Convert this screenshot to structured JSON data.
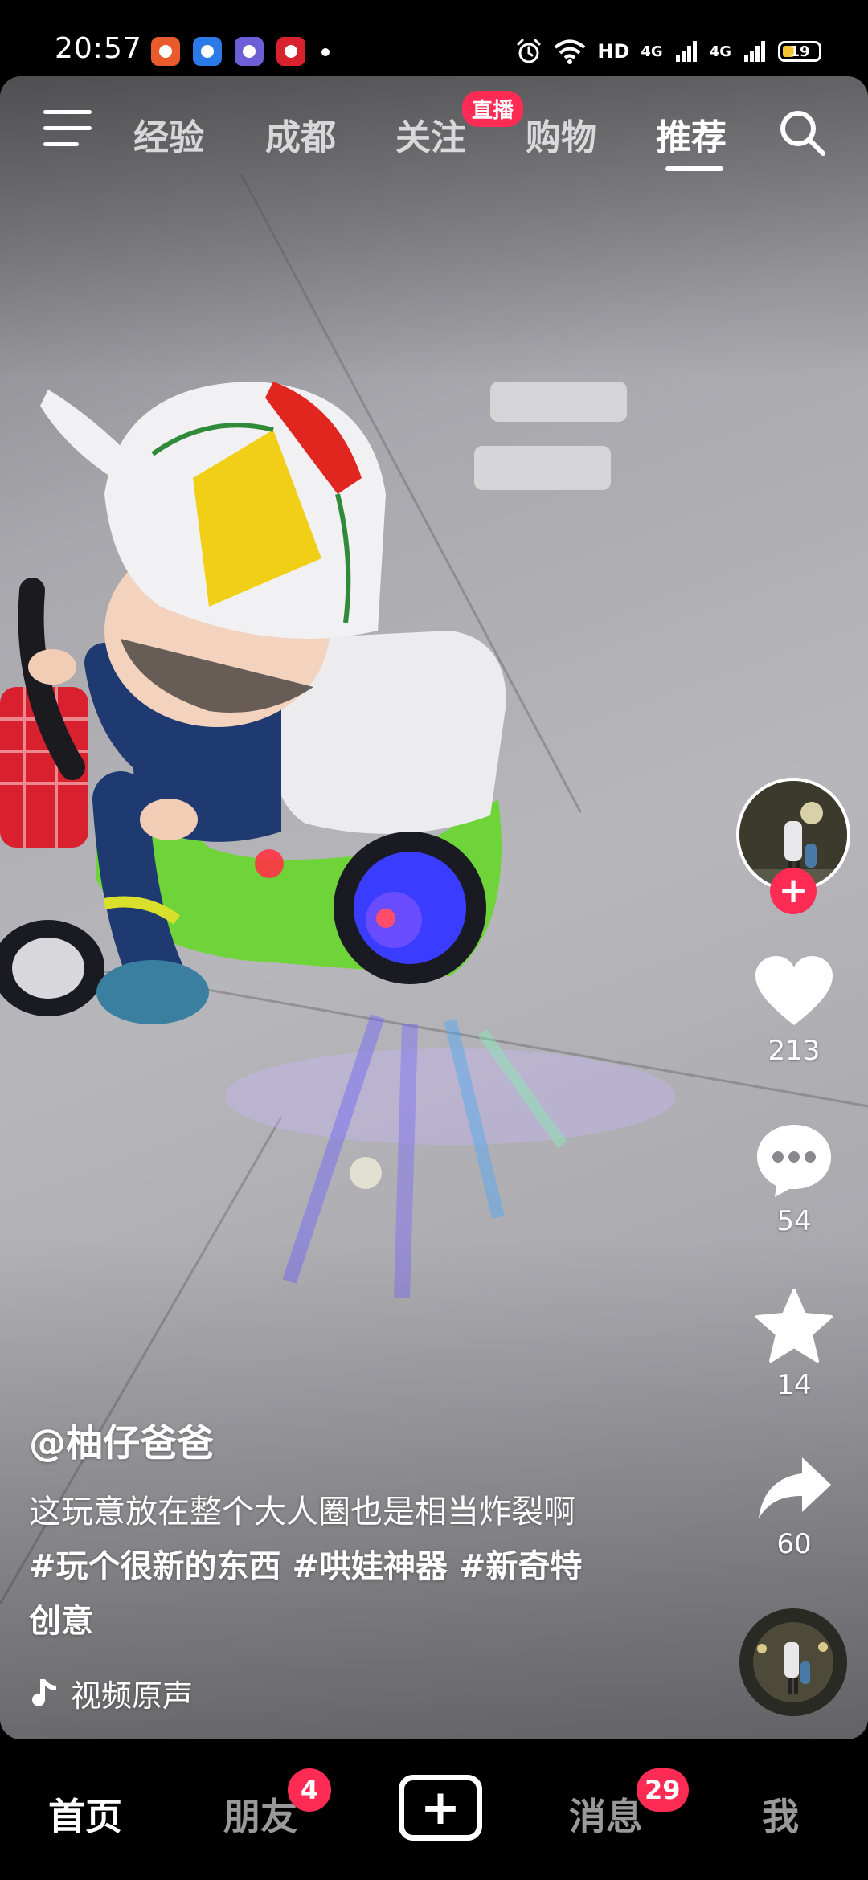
{
  "status_bar": {
    "time": "20:57",
    "network": "HD",
    "signal_1": "4G",
    "signal_2": "4G",
    "battery": "19",
    "icons": [
      "alarm-icon",
      "wifi-icon",
      "signal-icon",
      "battery-icon"
    ]
  },
  "top_nav": {
    "tabs": [
      {
        "label": "经验"
      },
      {
        "label": "成都"
      },
      {
        "label": "关注"
      },
      {
        "label": "购物"
      },
      {
        "label": "推荐"
      }
    ],
    "active_tab": "推荐",
    "live_badge": "直播"
  },
  "video": {
    "author": "@柚仔爸爸",
    "description": "这玩意放在整个大人圈也是相当炸裂啊",
    "tags_line_1": "#玩个很新的东西 #哄娃神器 #新奇特",
    "tags_line_2": "创意",
    "music": "视频原声"
  },
  "actions": {
    "likes": "213",
    "comments": "54",
    "favorites": "14",
    "shares": "60"
  },
  "bottom_nav": {
    "home": "首页",
    "friends": "朋友",
    "friends_badge": "4",
    "messages": "消息",
    "messages_badge": "29",
    "me": "我"
  },
  "colors": {
    "accent": "#fe2c55",
    "background": "#000000"
  }
}
